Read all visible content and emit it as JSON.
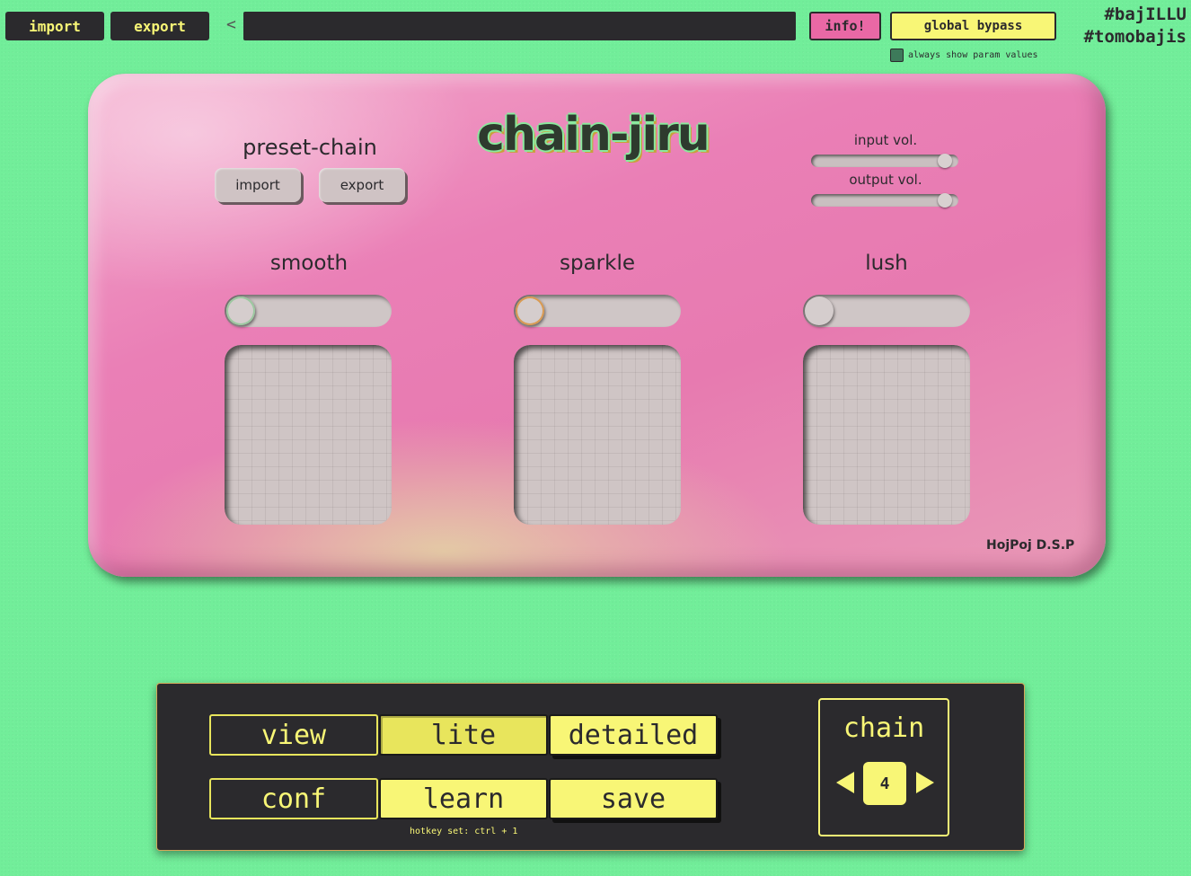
{
  "topbar": {
    "import_label": "import",
    "export_label": "export",
    "back_glyph": "<",
    "address_value": "",
    "info_label": "info!",
    "bypass_label": "global bypass",
    "always_show_label": "always show param values",
    "always_show_checked": true,
    "hashtag_1": "#bajILLU",
    "hashtag_2": "#tomobajis"
  },
  "plugin": {
    "logo_text": "chain-jiru",
    "preset_title": "preset-chain",
    "preset_import": "import",
    "preset_export": "export",
    "input_vol_label": "input vol.",
    "input_vol": 0.95,
    "output_vol_label": "output vol.",
    "output_vol": 0.95,
    "effects": [
      {
        "name": "smooth",
        "enabled": false
      },
      {
        "name": "sparkle",
        "enabled": false
      },
      {
        "name": "lush",
        "enabled": false
      }
    ],
    "brand": "HojPoj D.S.P"
  },
  "controls": {
    "view_label": "view",
    "lite_label": "lite",
    "detailed_label": "detailed",
    "conf_label": "conf",
    "learn_label": "learn",
    "save_label": "save",
    "hotkey_text": "hotkey set: ctrl + 1",
    "chain_label": "chain",
    "chain_number": "4"
  },
  "colors": {
    "background": "#72ee9a",
    "dark": "#2b2a2d",
    "accent_yellow": "#f8f676",
    "accent_pink": "#e968a5"
  }
}
